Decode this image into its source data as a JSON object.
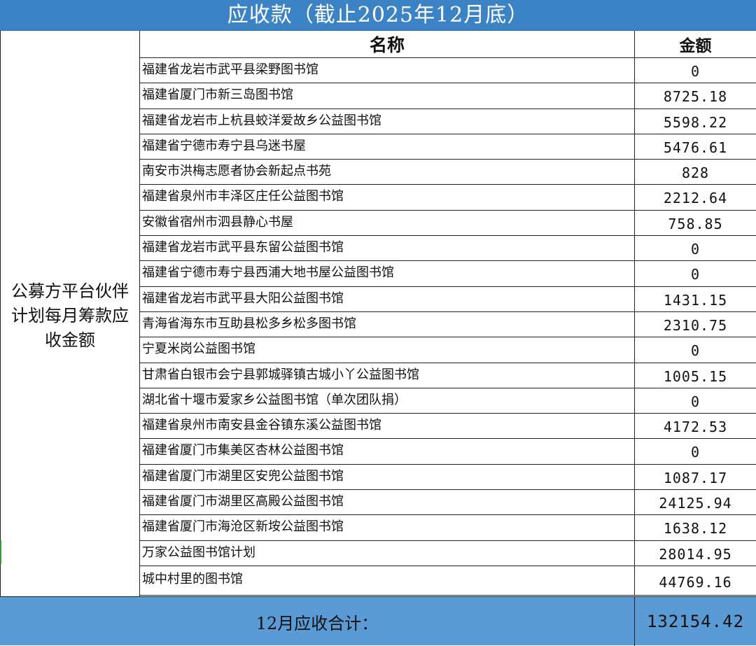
{
  "title": "应收款（截止2025年12月底）",
  "left_label": "公募方平台伙伴计划每月筹款应收金额",
  "columns": {
    "name": "名称",
    "amount": "金额"
  },
  "rows": [
    {
      "name": "福建省龙岩市武平县梁野图书馆",
      "amount": "0"
    },
    {
      "name": "福建省厦门市新三岛图书馆",
      "amount": "8725.18"
    },
    {
      "name": "福建省龙岩市上杭县蛟洋爱故乡公益图书馆",
      "amount": "5598.22"
    },
    {
      "name": "福建省宁德市寿宁县乌迷书屋",
      "amount": "5476.61"
    },
    {
      "name": "南安市洪梅志愿者协会新起点书苑",
      "amount": "828"
    },
    {
      "name": "福建省泉州市丰泽区庄任公益图书馆",
      "amount": "2212.64"
    },
    {
      "name": "安徽省宿州市泗县静心书屋",
      "amount": "758.85"
    },
    {
      "name": "福建省龙岩市武平县东留公益图书馆",
      "amount": "0"
    },
    {
      "name": "福建省宁德市寿宁县西浦大地书屋公益图书馆",
      "amount": "0"
    },
    {
      "name": "福建省龙岩市武平县大阳公益图书馆",
      "amount": "1431.15"
    },
    {
      "name": "青海省海东市互助县松多乡松多图书馆",
      "amount": "2310.75"
    },
    {
      "name": "宁夏米岗公益图书馆",
      "amount": "0"
    },
    {
      "name": "甘肃省白银市会宁县郭城驿镇古城小丫公益图书馆",
      "amount": "1005.15"
    },
    {
      "name": "湖北省十堰市爱家乡公益图书馆（单次团队捐）",
      "amount": "0"
    },
    {
      "name": "福建省泉州市南安县金谷镇东溪公益图书馆",
      "amount": "4172.53"
    },
    {
      "name": "福建省厦门市集美区杏林公益图书馆",
      "amount": "0"
    },
    {
      "name": "福建省厦门市湖里区安兜公益图书馆",
      "amount": "1087.17"
    },
    {
      "name": "福建省厦门市湖里区高殿公益图书馆",
      "amount": "24125.94"
    },
    {
      "name": "福建省厦门市海沧区新垵公益图书馆",
      "amount": "1638.12"
    },
    {
      "name": "万家公益图书馆计划",
      "amount": "28014.95"
    },
    {
      "name": "城中村里的图书馆",
      "amount": "44769.16"
    }
  ],
  "total": {
    "label": "12月应收合计：",
    "value": "132154.42"
  },
  "colors": {
    "title_bg": "#3c83c6",
    "total_bg": "#5b9bd5",
    "grid": "#222222"
  }
}
